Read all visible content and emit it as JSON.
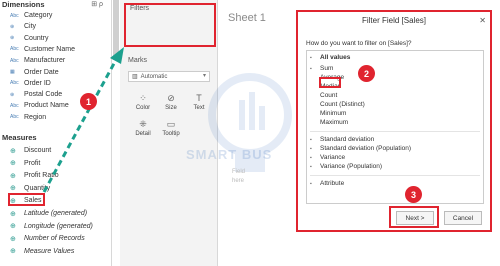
{
  "data_pane": {
    "dimensions_header": "Dimensions",
    "measures_header": "Measures",
    "dimensions": [
      {
        "type": "Abc",
        "label": "Category"
      },
      {
        "type": "globe",
        "label": "City"
      },
      {
        "type": "globe",
        "label": "Country"
      },
      {
        "type": "Abc",
        "label": "Customer Name"
      },
      {
        "type": "Abc",
        "label": "Manufacturer"
      },
      {
        "type": "date",
        "label": "Order Date"
      },
      {
        "type": "Abc",
        "label": "Order ID"
      },
      {
        "type": "globe",
        "label": "Postal Code"
      },
      {
        "type": "Abc",
        "label": "Product Name"
      },
      {
        "type": "Abc",
        "label": "Region"
      }
    ],
    "measures": [
      {
        "label": "Discount",
        "italic": false
      },
      {
        "label": "Profit",
        "italic": false
      },
      {
        "label": "Profit Ratio",
        "italic": false
      },
      {
        "label": "Quantity",
        "italic": false
      },
      {
        "label": "Sales",
        "italic": false
      },
      {
        "label": "Latitude (generated)",
        "italic": true
      },
      {
        "label": "Longitude (generated)",
        "italic": true
      },
      {
        "label": "Number of Records",
        "italic": true
      },
      {
        "label": "Measure Values",
        "italic": true
      }
    ]
  },
  "cards": {
    "filters_label": "Filters",
    "marks_label": "Marks",
    "marks_type": "Automatic",
    "mark_buttons": [
      {
        "icon": "color-icon",
        "label": "Color"
      },
      {
        "icon": "size-icon",
        "label": "Size"
      },
      {
        "icon": "text-icon",
        "label": "Text"
      },
      {
        "icon": "detail-icon",
        "label": "Detail"
      },
      {
        "icon": "tooltip-icon",
        "label": "Tooltip"
      }
    ]
  },
  "sheet": {
    "title": "Sheet 1",
    "hint": "Field\nhere",
    "watermark": "SMART BUS"
  },
  "dialog": {
    "title": "Filter Field [Sales]",
    "question": "How do you want to filter on [Sales]?",
    "items_top": [
      {
        "label": "All values",
        "bold": true,
        "sub": false
      },
      {
        "label": "Sum",
        "bold": false,
        "sub": false
      },
      {
        "label": "Average",
        "bold": false,
        "sub": true
      },
      {
        "label": "Median",
        "bold": false,
        "sub": true
      },
      {
        "label": "Count",
        "bold": false,
        "sub": true
      },
      {
        "label": "Count (Distinct)",
        "bold": false,
        "sub": true
      },
      {
        "label": "Minimum",
        "bold": false,
        "sub": true
      },
      {
        "label": "Maximum",
        "bold": false,
        "sub": true
      }
    ],
    "items_stats": [
      {
        "label": "Standard deviation"
      },
      {
        "label": "Standard deviation (Population)"
      },
      {
        "label": "Variance"
      },
      {
        "label": "Variance (Population)"
      }
    ],
    "item_attribute": "Attribute",
    "next_label": "Next >",
    "cancel_label": "Cancel"
  },
  "badges": {
    "step1": "1",
    "step2": "2",
    "step3": "3"
  },
  "colors": {
    "highlight": "#e0242f",
    "arrow": "#1ca08e",
    "accent": "#4a7fb5"
  }
}
